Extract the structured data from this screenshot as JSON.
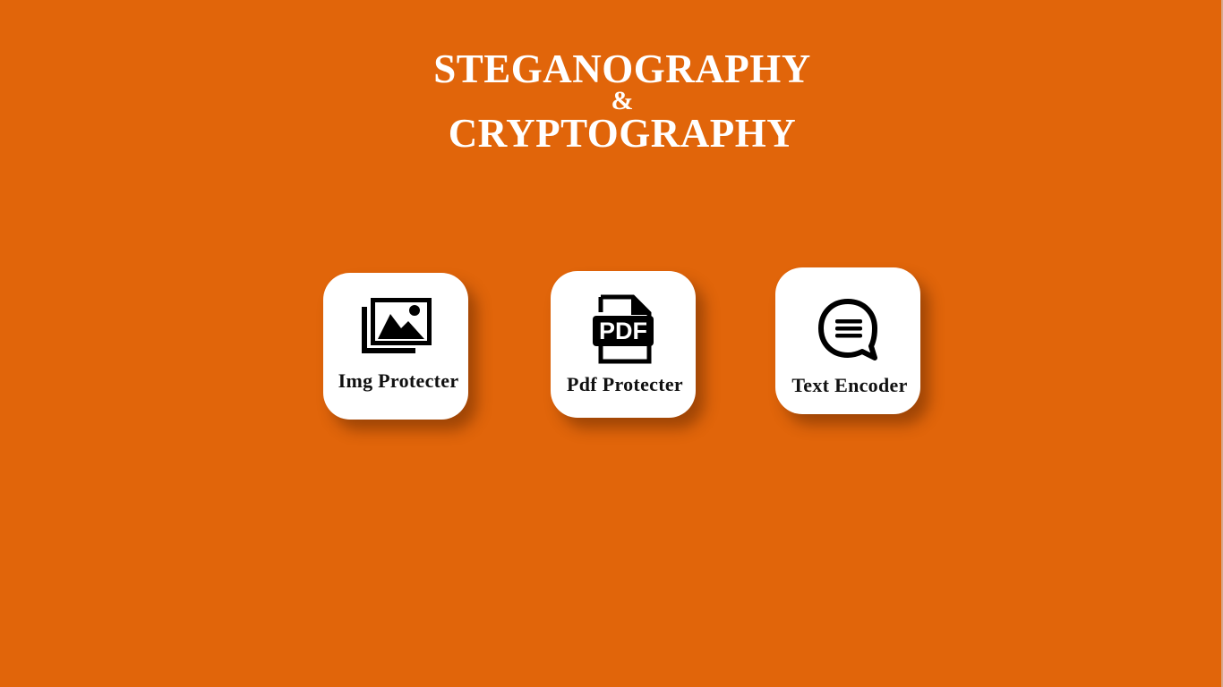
{
  "header": {
    "title_line1": "STEGANOGRAPHY",
    "title_amp": "&",
    "title_line2": "CRYPTOGRAPHY"
  },
  "cards": [
    {
      "label": "Img Protecter",
      "icon": "image-gallery-icon"
    },
    {
      "label": "Pdf Protecter",
      "icon": "pdf-file-icon",
      "icon_text": "PDF"
    },
    {
      "label": "Text Encoder",
      "icon": "chat-bubble-icon"
    }
  ],
  "colors": {
    "background": "#e1650a",
    "card": "#ffffff",
    "title": "#ffffff",
    "label": "#111111"
  }
}
